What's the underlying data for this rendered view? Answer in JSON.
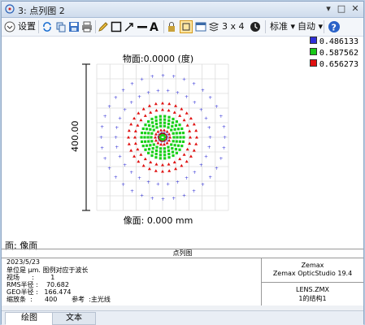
{
  "window": {
    "title": "3: 点列图 2",
    "controls": [
      "▾",
      "□",
      "✕"
    ]
  },
  "toolbar": {
    "settings_label": "设置",
    "layout_label": "3 x 4",
    "standard_label": "标准",
    "auto_label": "自动"
  },
  "legend": [
    {
      "value": "0.486133",
      "color": "#2f2fd8"
    },
    {
      "value": "0.587562",
      "color": "#18c818"
    },
    {
      "value": "0.656273",
      "color": "#e01010"
    }
  ],
  "plot": {
    "object_label": "物面:0.0000 (度)",
    "image_label": "像面: 0.000 mm",
    "scale_label": "400.00"
  },
  "surface_label": "面: 像面",
  "info": {
    "header": "点列图",
    "date": "2023/5/23",
    "units": "单位是 μm. 图例对应于波长",
    "field": "视场      :        1",
    "rms": "RMS半径 :    70.682",
    "geo": "GEO半径 :   166.474",
    "scale": "缩放条  :      400       参考  :主光线",
    "vendor": "Zemax",
    "product": "Zemax OpticStudio 19.4",
    "file": "LENS.ZMX",
    "config": "1的结构1"
  },
  "tabs": [
    "绘图",
    "文本"
  ]
}
